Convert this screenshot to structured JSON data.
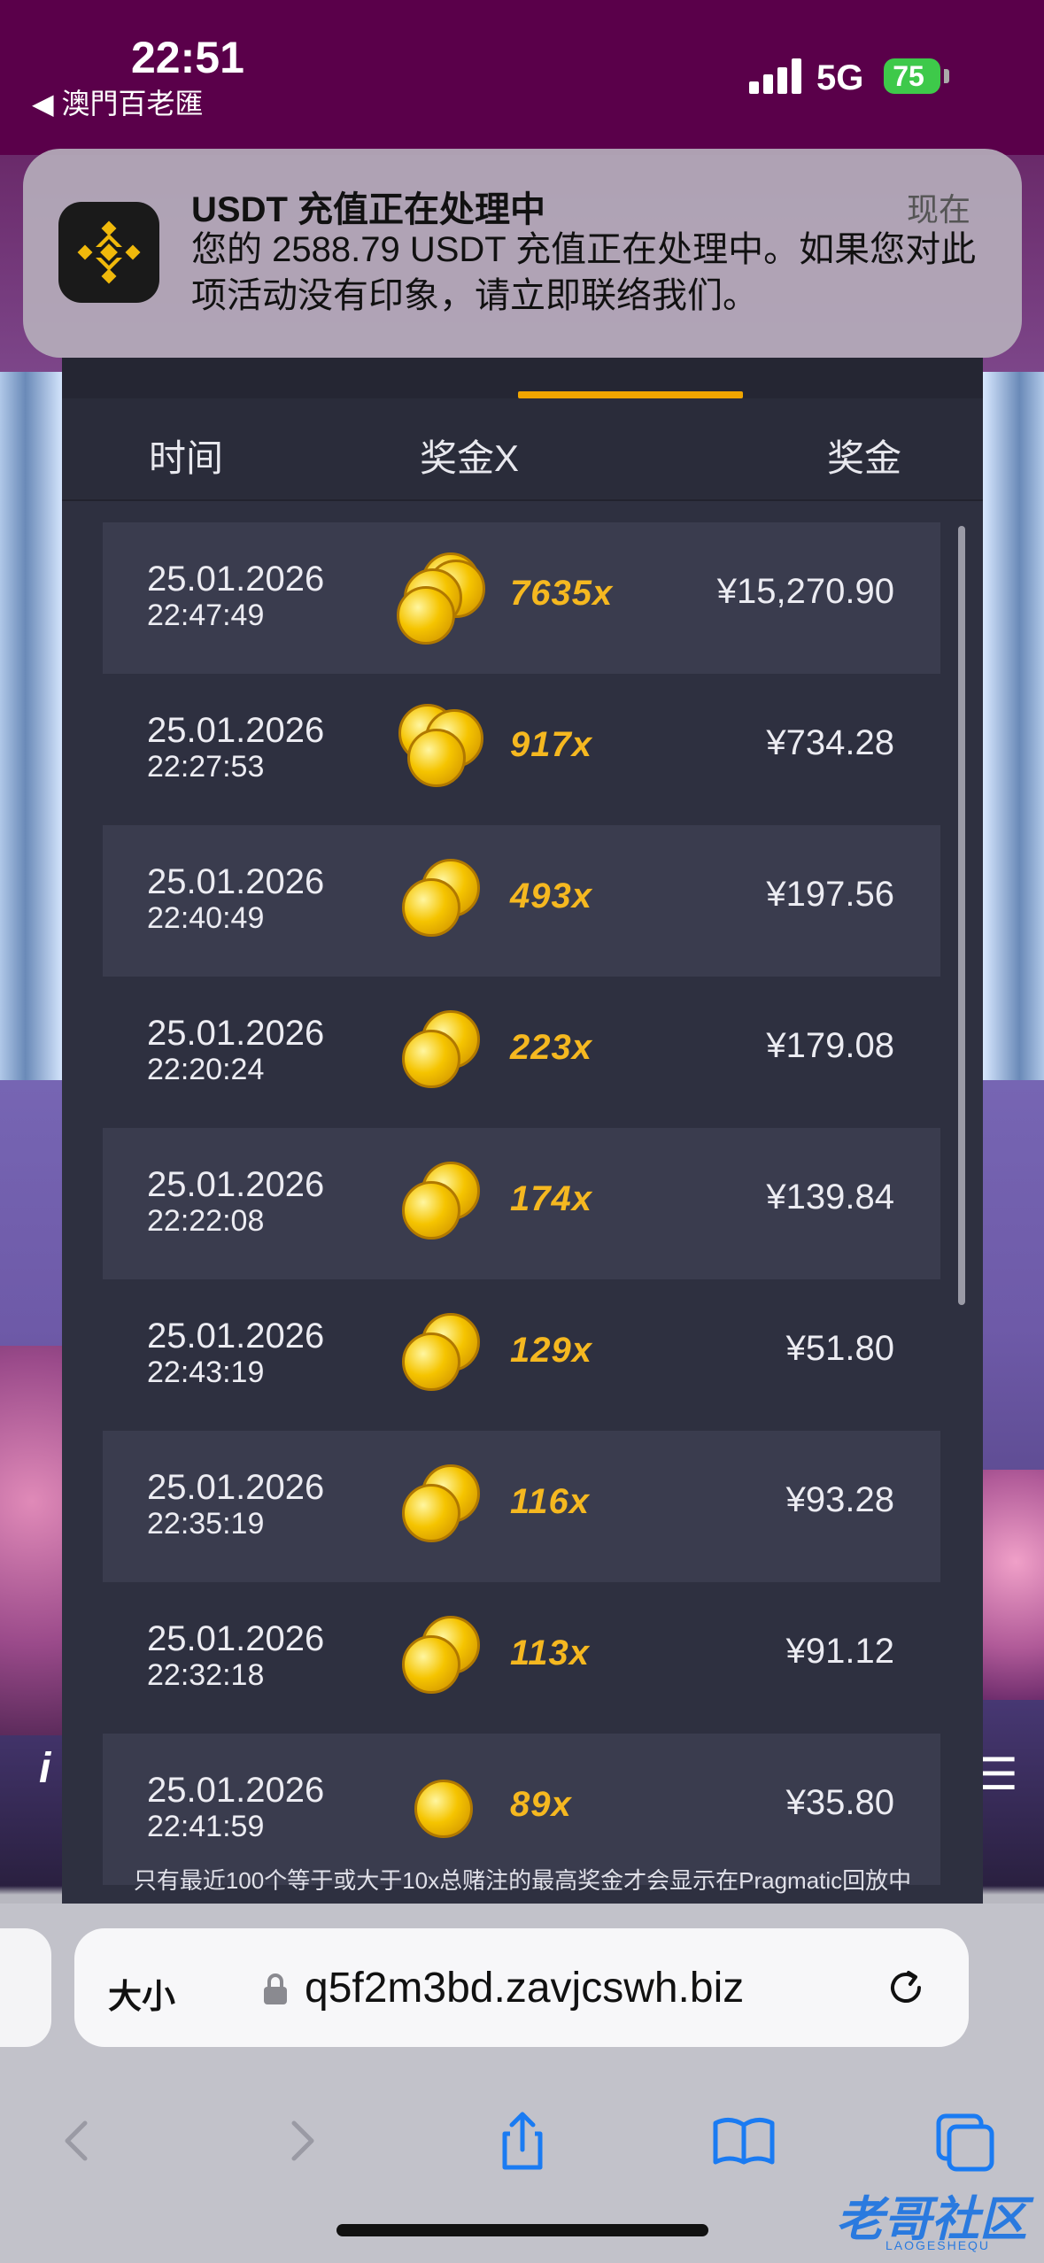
{
  "status_bar": {
    "time": "22:51",
    "back_app": "◀ 澳門百老匯",
    "network": "5G",
    "battery": "75"
  },
  "notification": {
    "title": "USDT 充值正在处理中",
    "time": "现在",
    "body": "您的 2588.79 USDT 充值正在处理中。如果您对此项活动没有印象，请立即联络我们。"
  },
  "table": {
    "headers": {
      "time": "时间",
      "multiplier": "奖金X",
      "prize": "奖金"
    },
    "rows": [
      {
        "date": "25.01.2026",
        "clock": "22:47:49",
        "multiplier": "7635x",
        "amount": "¥15,270.90",
        "coins": 4
      },
      {
        "date": "25.01.2026",
        "clock": "22:27:53",
        "multiplier": "917x",
        "amount": "¥734.28",
        "coins": 3
      },
      {
        "date": "25.01.2026",
        "clock": "22:40:49",
        "multiplier": "493x",
        "amount": "¥197.56",
        "coins": 2
      },
      {
        "date": "25.01.2026",
        "clock": "22:20:24",
        "multiplier": "223x",
        "amount": "¥179.08",
        "coins": 2
      },
      {
        "date": "25.01.2026",
        "clock": "22:22:08",
        "multiplier": "174x",
        "amount": "¥139.84",
        "coins": 2
      },
      {
        "date": "25.01.2026",
        "clock": "22:43:19",
        "multiplier": "129x",
        "amount": "¥51.80",
        "coins": 2
      },
      {
        "date": "25.01.2026",
        "clock": "22:35:19",
        "multiplier": "116x",
        "amount": "¥93.28",
        "coins": 2
      },
      {
        "date": "25.01.2026",
        "clock": "22:32:18",
        "multiplier": "113x",
        "amount": "¥91.12",
        "coins": 2
      },
      {
        "date": "25.01.2026",
        "clock": "22:41:59",
        "multiplier": "89x",
        "amount": "¥35.80",
        "coins": 1
      }
    ],
    "footnote": "只有最近100个等于或大于10x总赌注的最高奖金才会显示在Pragmatic回放中"
  },
  "browser": {
    "text_size_label": "大小",
    "url": "q5f2m3bd.zavjcswh.biz"
  },
  "watermark": {
    "text": "老哥社区",
    "sub": "LAOGESHEQU"
  },
  "colors": {
    "accent": "#f0a500",
    "multiplier": "#f5b820",
    "panel": "#2e3040",
    "status_bg": "#5a004a"
  }
}
